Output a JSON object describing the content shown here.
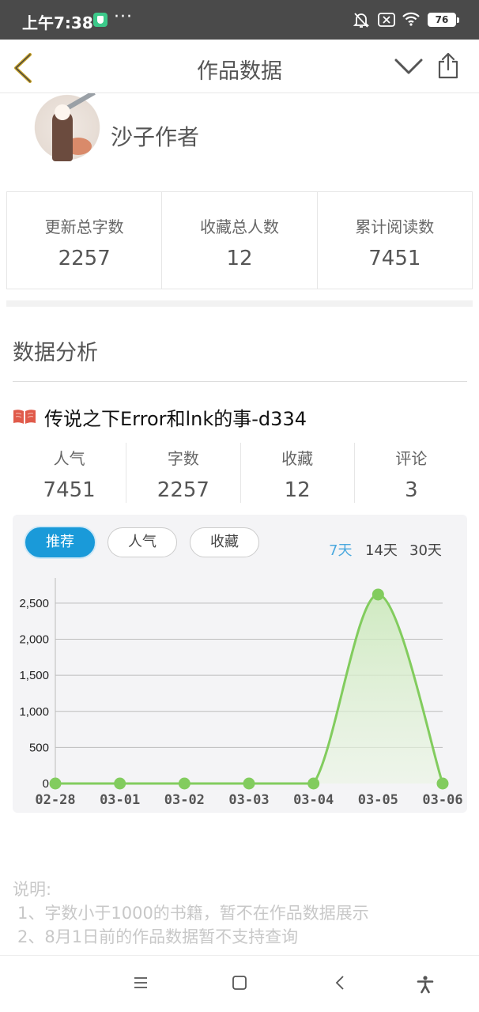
{
  "status_bar": {
    "time": "上午7:38",
    "more": "···",
    "battery": "76",
    "icons": [
      "shield-icon",
      "bell-muted-icon",
      "sim-off-icon",
      "wifi-icon",
      "battery-icon"
    ]
  },
  "nav": {
    "title": "作品数据",
    "icons": [
      "back-chevron-icon",
      "chevron-down-icon",
      "share-icon"
    ],
    "accent": "#c9a227"
  },
  "author": {
    "name": "沙子作者"
  },
  "summary_stats": [
    {
      "label": "更新总字数",
      "value": "2257"
    },
    {
      "label": "收藏总人数",
      "value": "12"
    },
    {
      "label": "累计阅读数",
      "value": "7451"
    }
  ],
  "analysis": {
    "title": "数据分析"
  },
  "book": {
    "title": "传说之下Error和lnk的事-d334",
    "icon": "open-book-icon",
    "icon_color": "#e05a4a",
    "stats": [
      {
        "label": "人气",
        "value": "7451"
      },
      {
        "label": "字数",
        "value": "2257"
      },
      {
        "label": "收藏",
        "value": "12"
      },
      {
        "label": "评论",
        "value": "3"
      }
    ]
  },
  "chart_tabs": {
    "metrics": [
      {
        "label": "推荐",
        "active": true
      },
      {
        "label": "人气",
        "active": false
      },
      {
        "label": "收藏",
        "active": false
      }
    ],
    "ranges": [
      {
        "label": "7天",
        "active": true
      },
      {
        "label": "14天",
        "active": false
      },
      {
        "label": "30天",
        "active": false
      }
    ],
    "active_color": "#1a9ad9"
  },
  "chart_data": {
    "type": "area",
    "categories": [
      "02-28",
      "03-01",
      "03-02",
      "03-03",
      "03-04",
      "03-05",
      "03-06"
    ],
    "series": [
      {
        "values": [
          0,
          0,
          0,
          0,
          0,
          2620,
          0
        ],
        "color": "#82cc5e"
      }
    ],
    "yticks": [
      0,
      500,
      1000,
      1500,
      2000,
      2500
    ],
    "ytick_labels": [
      "0",
      "500",
      "1,000",
      "1,500",
      "2,000",
      "2,500"
    ],
    "ylim": [
      0,
      2850
    ],
    "smooth": true,
    "grid": true,
    "legend": "none"
  },
  "notes": {
    "heading": "说明:",
    "lines": [
      "1、字数小于1000的书籍，暂不在作品数据展示",
      "2、8月1日前的作品数据暂不支持查询"
    ]
  },
  "system_nav": {
    "icons": [
      "menu-icon",
      "home-icon",
      "back-icon",
      "accessibility-icon"
    ]
  }
}
